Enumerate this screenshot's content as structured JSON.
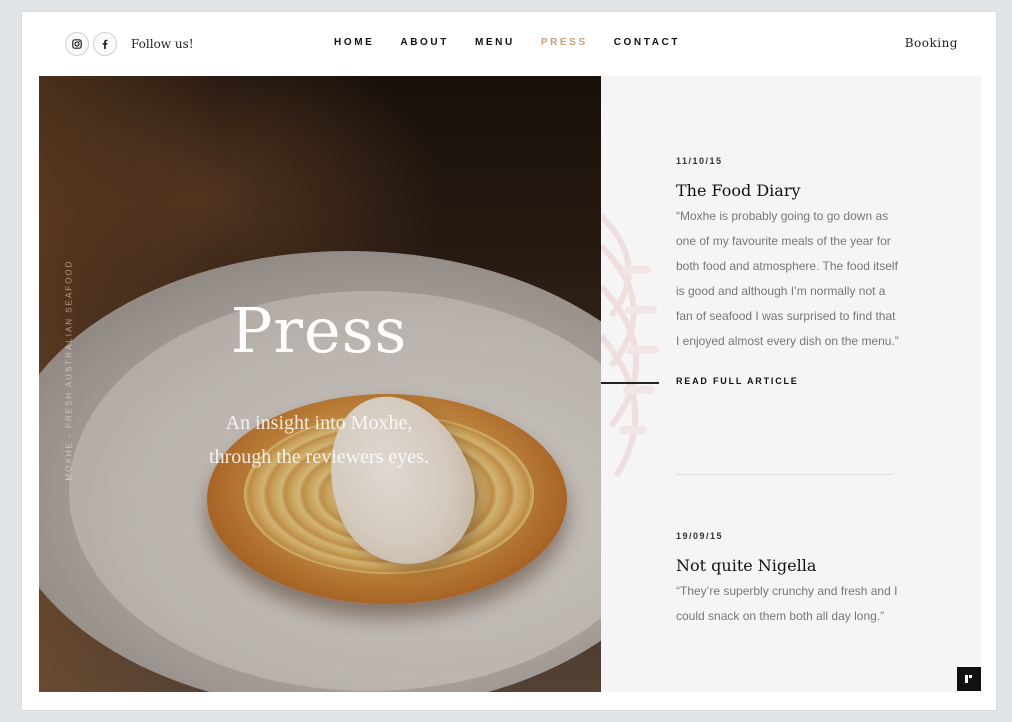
{
  "header": {
    "follow_label": "Follow us!",
    "booking_label": "Booking",
    "nav": [
      {
        "label": "HOME",
        "active": false
      },
      {
        "label": "ABOUT",
        "active": false
      },
      {
        "label": "MENU",
        "active": false
      },
      {
        "label": "PRESS",
        "active": true
      },
      {
        "label": "CONTACT",
        "active": false
      }
    ],
    "social_icons": [
      "instagram-icon",
      "facebook-icon"
    ]
  },
  "hero": {
    "title": "Press",
    "subtitle_line1": "An insight into Moxhe,",
    "subtitle_line2": "through the reviewers eyes.",
    "vertical_tag": "Moxhe - Fresh Australian Seafood"
  },
  "articles": [
    {
      "date": "11/10/15",
      "title": "The Food Diary",
      "quote": "“Moxhe is probably going to go down as one of my favourite meals of the year for both food and atmosphere. The food itself is good and although I’m normally not a fan of seafood I was surprised to find that I enjoyed almost every dish on the menu.”",
      "link_label": "READ FULL ARTICLE"
    },
    {
      "date": "19/09/15",
      "title": "Not quite Nigella",
      "quote": "“They’re superbly crunchy and fresh and I could snack on them both all day long.”"
    }
  ],
  "colors": {
    "accent": "#c9a078",
    "panel_bg": "#f5f5f5",
    "page_bg": "#e1e4e6"
  }
}
